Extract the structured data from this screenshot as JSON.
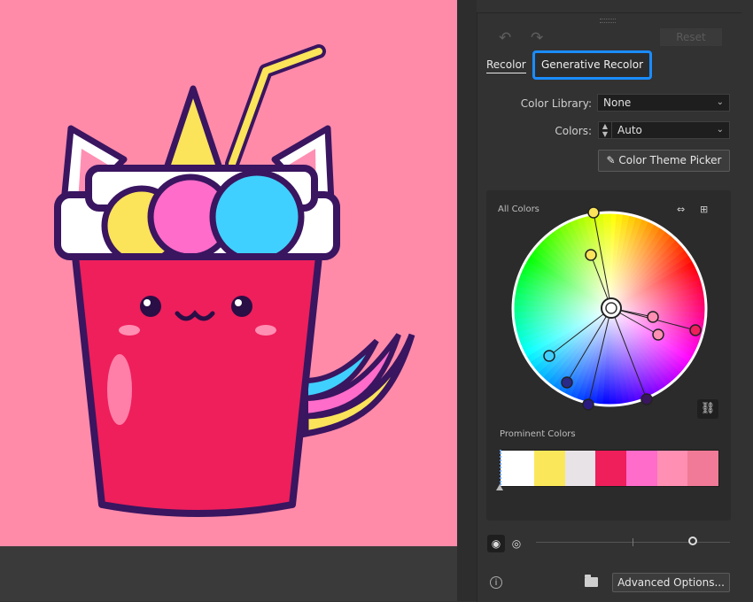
{
  "toolbar": {
    "undo_icon": "undo-icon",
    "redo_icon": "redo-icon",
    "reset_label": "Reset"
  },
  "tabs": [
    {
      "label": "Recolor",
      "active": true
    },
    {
      "label": "Generative Recolor",
      "highlighted": true
    }
  ],
  "color_library": {
    "label": "Color Library:",
    "value": "None"
  },
  "colors": {
    "label": "Colors:",
    "value": "Auto"
  },
  "theme_picker": {
    "label": "Color Theme Picker",
    "icon": "eyedropper-icon"
  },
  "wheel": {
    "all_colors_label": "All Colors",
    "icons": [
      "show-saturation-icon",
      "randomize-icon",
      "link-harmony-icon"
    ]
  },
  "prominent": {
    "label": "Prominent Colors",
    "swatches": [
      "#ffffff",
      "#fbe85a",
      "#e8e3e6",
      "#ee1f5b",
      "#ff6cc9",
      "#ff8fb3",
      "#f07a97"
    ]
  },
  "bottom": {
    "info_icon": "info-icon",
    "folder_icon": "folder-icon",
    "advanced_label": "Advanced Options..."
  },
  "colors_accent": {
    "highlight": "#1a8cff",
    "canvas_bg": "#ff8ba9"
  }
}
